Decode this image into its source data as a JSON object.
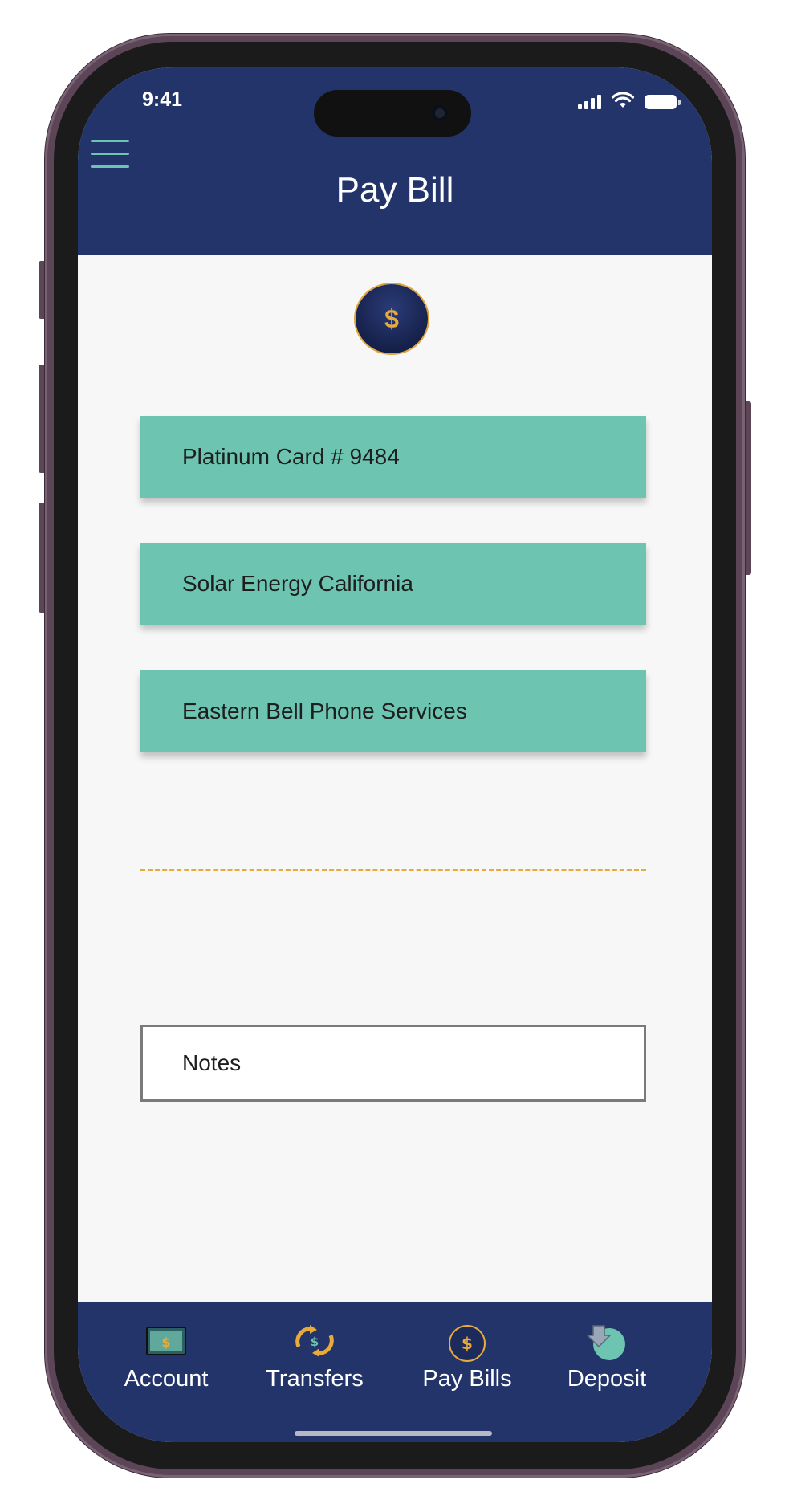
{
  "status_bar": {
    "time": "9:41"
  },
  "header": {
    "title": "Pay Bill",
    "menu_icon": "hamburger-menu-icon"
  },
  "hero": {
    "icon": "dollar-coin-icon",
    "symbol": "$"
  },
  "payees": [
    {
      "label": "Platinum Card # 9484"
    },
    {
      "label": "Solar Energy California"
    },
    {
      "label": "Eastern Bell Phone Services"
    }
  ],
  "notes": {
    "placeholder": "Notes"
  },
  "bottom_nav": {
    "items": [
      {
        "label": "Account",
        "icon": "wallet-icon"
      },
      {
        "label": "Transfers",
        "icon": "transfer-arrows-icon"
      },
      {
        "label": "Pay Bills",
        "icon": "dollar-coin-icon"
      },
      {
        "label": "Deposit",
        "icon": "deposit-icon"
      }
    ]
  },
  "colors": {
    "header_bg": "#23346a",
    "accent_teal": "#6cc4b1",
    "accent_gold": "#e8aa3a",
    "screen_bg": "#f7f7f7"
  }
}
